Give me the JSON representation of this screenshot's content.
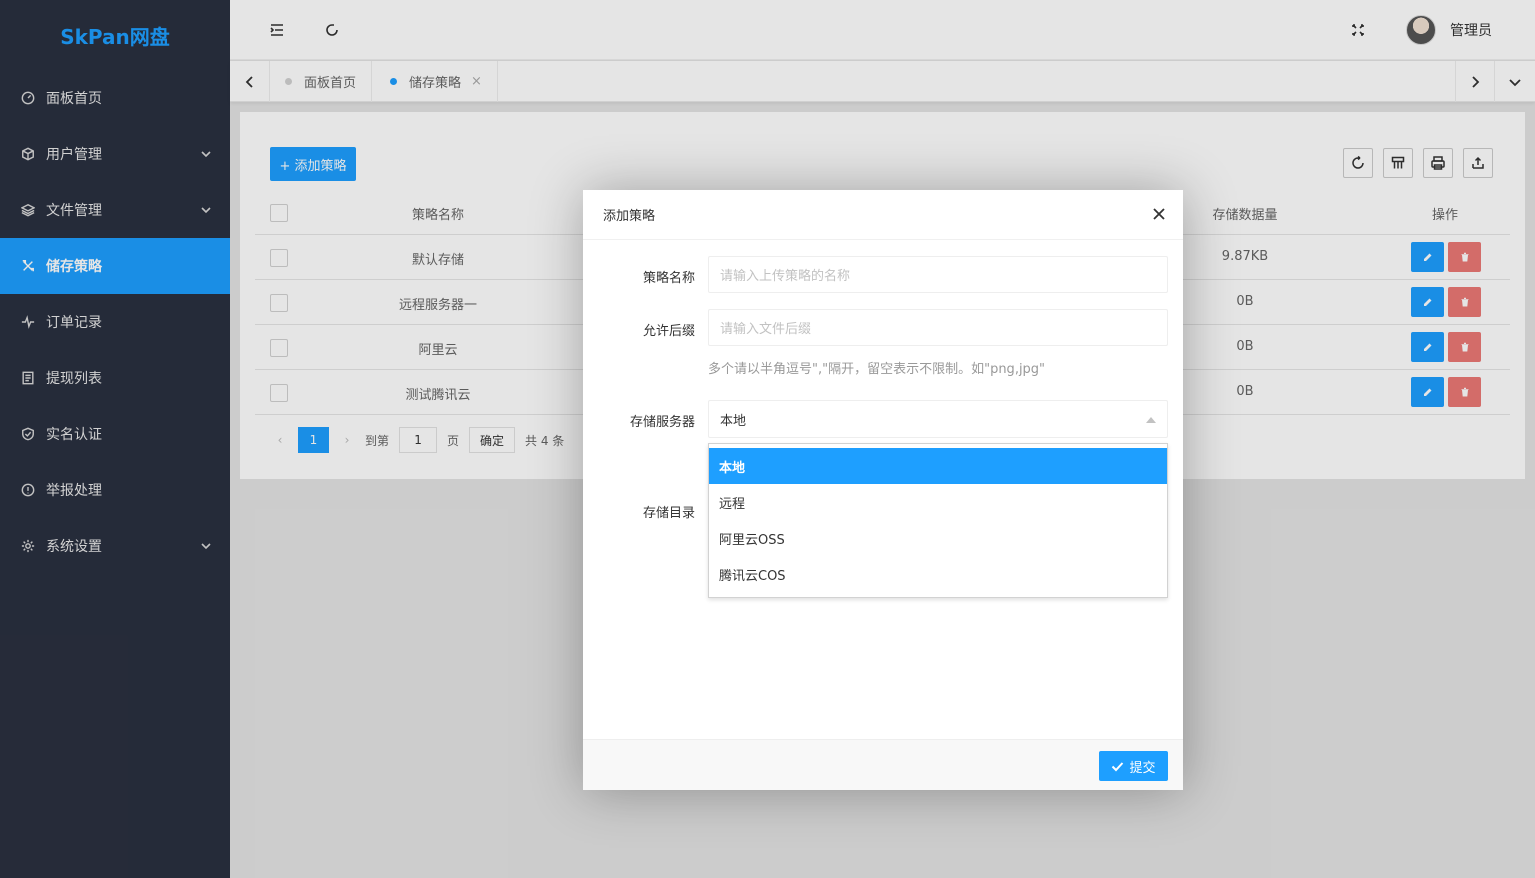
{
  "sidebar": {
    "logo": "SkPan网盘",
    "items": [
      {
        "label": "面板首页",
        "icon": "dashboard-icon"
      },
      {
        "label": "用户管理",
        "icon": "cube-icon",
        "has_children": true
      },
      {
        "label": "文件管理",
        "icon": "layers-icon",
        "has_children": true
      },
      {
        "label": "储存策略",
        "icon": "tools-icon",
        "active": true
      },
      {
        "label": "订单记录",
        "icon": "pulse-icon"
      },
      {
        "label": "提现列表",
        "icon": "list-icon"
      },
      {
        "label": "实名认证",
        "icon": "shield-check-icon"
      },
      {
        "label": "举报处理",
        "icon": "alert-icon"
      },
      {
        "label": "系统设置",
        "icon": "gear-icon",
        "has_children": true
      }
    ]
  },
  "header": {
    "username": "管理员"
  },
  "tabs": [
    {
      "label": "面板首页",
      "active": false
    },
    {
      "label": "储存策略",
      "active": true,
      "close": "×"
    }
  ],
  "toolbar": {
    "add_label": "+ 添加策略"
  },
  "table": {
    "headers": {
      "name": "策略名称",
      "size": "存储数据量",
      "op": "操作"
    },
    "rows": [
      {
        "name": "默认存储",
        "size": "9.87KB"
      },
      {
        "name": "远程服务器一",
        "size": "0B"
      },
      {
        "name": "阿里云",
        "size": "0B"
      },
      {
        "name": "测试腾讯云",
        "size": "0B"
      }
    ]
  },
  "pager": {
    "current": "1",
    "goto_label": "到第",
    "goto_value": "1",
    "page_label": "页",
    "confirm": "确定",
    "total": "共 4 条"
  },
  "modal": {
    "title": "添加策略",
    "fields": {
      "name_label": "策略名称",
      "name_placeholder": "请输入上传策略的名称",
      "suffix_label": "允许后缀",
      "suffix_placeholder": "请输入文件后缀",
      "suffix_tip": "多个请以半角逗号\",\"隔开，留空表示不限制。如\"png,jpg\"",
      "server_label": "存储服务器",
      "server_value": "本地",
      "dir_label": "存储目录"
    },
    "dropdown_options": [
      "本地",
      "远程",
      "阿里云OSS",
      "腾讯云COS"
    ],
    "selected_option": "本地",
    "submit_label": "提交"
  },
  "colors": {
    "accent": "#1e9fff",
    "danger": "#e8625d",
    "sidebar_bg": "#2a3040"
  }
}
